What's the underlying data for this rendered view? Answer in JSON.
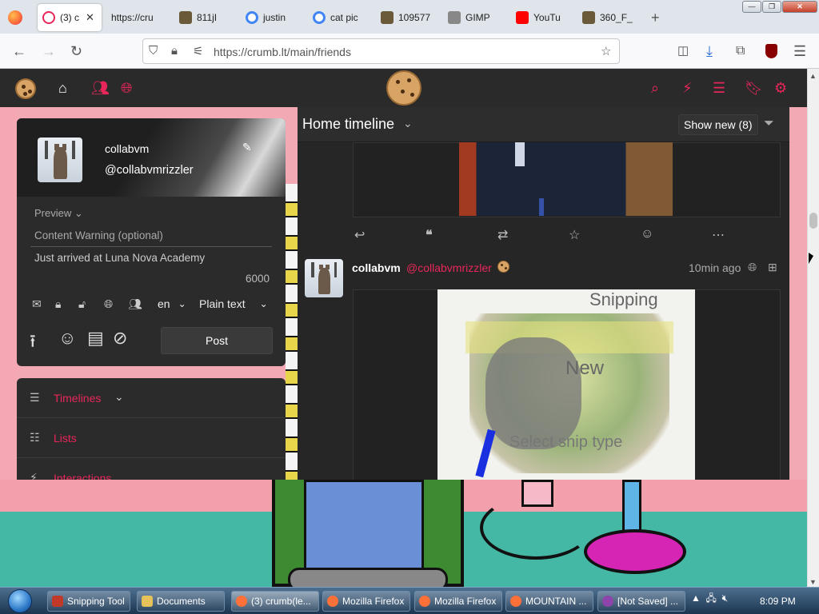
{
  "browser": {
    "tabs": [
      {
        "label": "(3) c",
        "active": true,
        "favicon_color": "#e8265a"
      },
      {
        "label": "https://cru",
        "favicon_color": ""
      },
      {
        "label": "811jI",
        "favicon_color": "#6b5a3a"
      },
      {
        "label": "justin",
        "favicon_color": "#4285f4"
      },
      {
        "label": "cat pic",
        "favicon_color": "#4285f4"
      },
      {
        "label": "109577",
        "favicon_color": "#6b5a3a"
      },
      {
        "label": "GIMP",
        "favicon_color": "#888888"
      },
      {
        "label": "YouTu",
        "favicon_color": "#ff0000"
      },
      {
        "label": "360_F_",
        "favicon_color": "#6b5a3a"
      }
    ],
    "url_display": "https://crumb.lt/main/friends",
    "window_controls": [
      "minimize-icon",
      "maximize-icon",
      "close-icon"
    ]
  },
  "app": {
    "header_icons_left": [
      "home-icon",
      "users-icon",
      "globe-icon"
    ],
    "header_icons_right": [
      "search-icon",
      "bolt-icon",
      "list-icon",
      "bookmark-icon",
      "gear-icon"
    ],
    "accent_color": "#e8265a"
  },
  "compose": {
    "display_name": "collabvm",
    "handle": "@collabvmrizzler",
    "preview_label": "Preview",
    "cw_placeholder": "Content Warning (optional)",
    "text_value": "Just arrived at Luna Nova Academy",
    "char_count": "6000",
    "language": "en",
    "format": "Plain text",
    "post_label": "Post",
    "visibility_icons": [
      "mail-icon",
      "lock-icon",
      "unlock-icon",
      "globe-icon",
      "users-icon"
    ],
    "tool_icons": [
      "upload-icon",
      "emoji-icon",
      "poll-icon",
      "eye-off-icon"
    ]
  },
  "menu": {
    "items": [
      {
        "label": "Timelines",
        "icon": "bars-icon",
        "has_chevron": true
      },
      {
        "label": "Lists",
        "icon": "list-icon"
      },
      {
        "label": "Interactions",
        "icon": "bolt-icon"
      }
    ]
  },
  "timeline": {
    "title": "Home timeline",
    "show_new_label": "Show new (8)",
    "actions": [
      "reply-icon",
      "quote-icon",
      "retweet-icon",
      "star-icon",
      "emoji-icon",
      "more-icon"
    ],
    "post": {
      "author": "collabvm",
      "handle": "@collabvmrizzler",
      "time": "10min ago",
      "image_text": {
        "title": "Snipping",
        "new": "New",
        "select": "Select snip type"
      }
    }
  },
  "taskbar": {
    "items": [
      {
        "label": "Snipping Tool",
        "icon_color": "#c0392b"
      },
      {
        "label": "Documents",
        "icon_color": "#e6c35a"
      },
      {
        "label": "(3) crumb(le...",
        "icon_color": "#ff7139",
        "active": true
      },
      {
        "label": "Mozilla Firefox",
        "icon_color": "#ff7139"
      },
      {
        "label": "Mozilla Firefox",
        "icon_color": "#ff7139"
      },
      {
        "label": "MOUNTAIN ...",
        "icon_color": "#ff7139"
      },
      {
        "label": "[Not Saved] ...",
        "icon_color": "#8e44ad"
      }
    ],
    "clock": "8:09 PM"
  }
}
